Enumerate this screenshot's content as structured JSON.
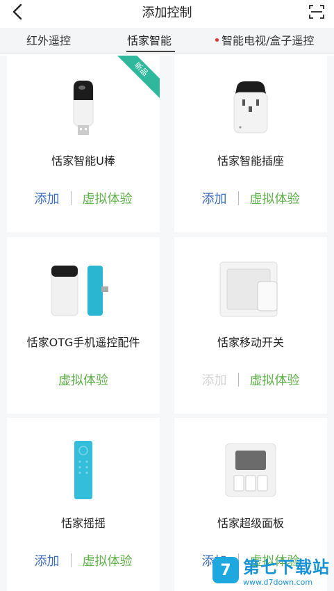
{
  "header": {
    "title": "添加控制"
  },
  "tabs": [
    {
      "label": "红外遥控"
    },
    {
      "label": "恬家智能"
    },
    {
      "label": "智能电视/盒子遥控"
    }
  ],
  "cards": [
    {
      "name": "恬家智能U棒",
      "add": "添加",
      "try": "虚拟体验",
      "badge": "新品"
    },
    {
      "name": "恬家智能插座",
      "add": "添加",
      "try": "虚拟体验"
    },
    {
      "name": "恬家OTG手机遥控配件",
      "try": "虚拟体验"
    },
    {
      "name": "恬家移动开关",
      "add": "添加",
      "try": "虚拟体验"
    },
    {
      "name": "恬家摇摇",
      "add": "添加",
      "try": "虚拟体验"
    },
    {
      "name": "恬家超级面板",
      "add": "添加",
      "try": "虚拟体验"
    }
  ],
  "watermark": {
    "title": "第七下载站",
    "url": "www.d7down.com",
    "logo": "7"
  },
  "colors": {
    "add": "#3d6fb8",
    "try": "#5fb04a",
    "badge": "#2fb89b"
  }
}
